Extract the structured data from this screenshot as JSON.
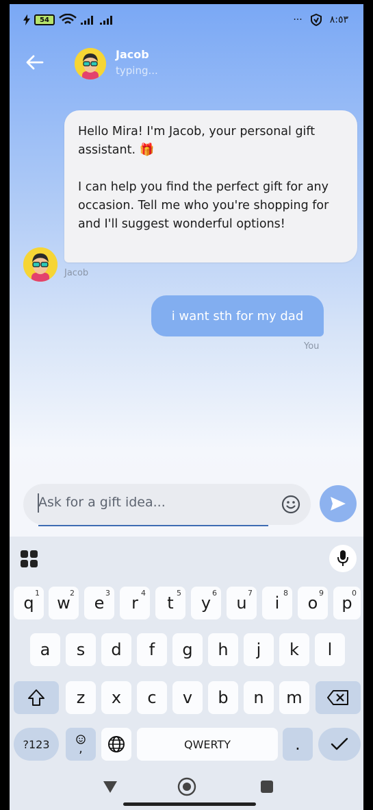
{
  "status_bar": {
    "battery": "54",
    "time": "٨:٥٣",
    "more": "···"
  },
  "header": {
    "name": "Jacob",
    "status": "typing..."
  },
  "messages": [
    {
      "sender": "Jacob",
      "paragraphs": [
        "Hello Mira! I'm Jacob, your personal gift assistant. 🎁",
        "I can help you find the perfect gift for any occasion. Tell me who you're shopping for and I'll suggest wonderful options!"
      ]
    },
    {
      "sender": "You",
      "text": "i want sth for my dad"
    }
  ],
  "input": {
    "placeholder": "Ask for a gift idea..."
  },
  "keyboard": {
    "row1": [
      [
        "q",
        "1"
      ],
      [
        "w",
        "2"
      ],
      [
        "e",
        "3"
      ],
      [
        "r",
        "4"
      ],
      [
        "t",
        "5"
      ],
      [
        "y",
        "6"
      ],
      [
        "u",
        "7"
      ],
      [
        "i",
        "8"
      ],
      [
        "o",
        "9"
      ],
      [
        "p",
        "0"
      ]
    ],
    "row2": [
      "a",
      "s",
      "d",
      "f",
      "g",
      "h",
      "j",
      "k",
      "l"
    ],
    "row3": [
      "z",
      "x",
      "c",
      "v",
      "b",
      "n",
      "m"
    ],
    "symbols_label": "?123",
    "emoji_label": ",",
    "space_label": "QWERTY",
    "period_label": "."
  },
  "colors": {
    "accent": "#82aef0",
    "send": "#8db2ef"
  }
}
